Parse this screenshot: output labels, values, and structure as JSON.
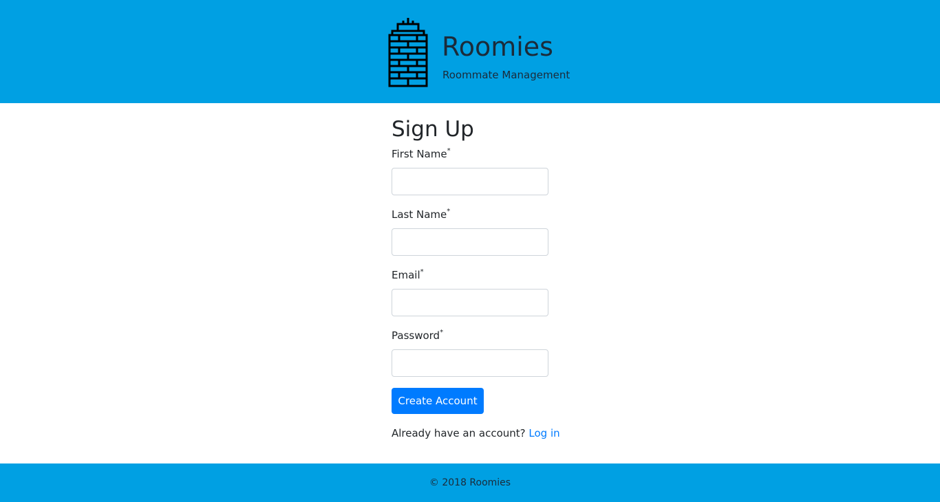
{
  "header": {
    "logo_icon": "skyscraper-icon",
    "title": "Roomies",
    "subtitle": "Roommate Management"
  },
  "form": {
    "title": "Sign Up",
    "required_marker": "*",
    "fields": [
      {
        "label": "First Name",
        "value": "",
        "placeholder": ""
      },
      {
        "label": "Last Name",
        "value": "",
        "placeholder": ""
      },
      {
        "label": "Email",
        "value": "",
        "placeholder": ""
      },
      {
        "label": "Password",
        "value": "",
        "placeholder": ""
      }
    ],
    "submit_label": "Create Account",
    "login_prompt": "Already have an account?",
    "login_link": "Log in"
  },
  "footer": {
    "text": "© 2018 Roomies"
  },
  "colors": {
    "header_bg": "#00a0e3",
    "footer_bg": "#00a0e3",
    "primary": "#007bff",
    "text": "#212529"
  }
}
